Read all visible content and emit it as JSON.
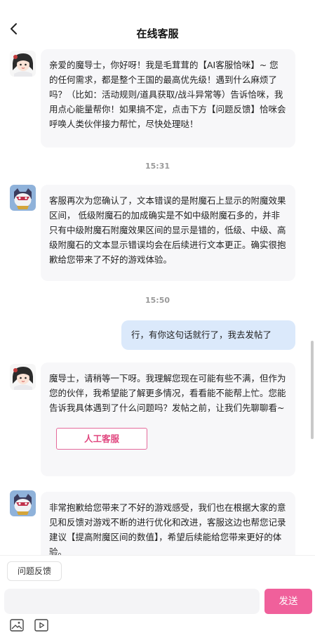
{
  "header": {
    "title": "在线客服",
    "back_icon": "chevron-left-icon"
  },
  "messages": [
    {
      "side": "left",
      "avatar": "anime-girl-avatar",
      "text": "亲爱的魔导士，你好呀！我是毛茸茸的【AI客服恰咪】~ 您的任何需求，都是整个王国的最高优先级！遇到什么麻烦了吗？（比如：活动规则/道具获取/战斗异常等）告诉恰咪，我用点心能量帮你！如果搞不定，点击下方【问题反馈】恰咪会呼唤人类伙伴接力帮忙，尽快处理哒！"
    },
    {
      "time": "15:31"
    },
    {
      "side": "left",
      "avatar": "robot-mascot-avatar",
      "text": "客服再次为您确认了，文本错误的是附魔石上显示的附魔效果区间，  低级附魔石的加成确实是不如中级附魔石多的，并非只有中级附魔石附魔效果区间的显示是错的，低级、中级、高级附魔石的文本显示错误均会在后续进行文本更正。确实很抱歉给您带来了不好的游戏体验。"
    },
    {
      "time": "15:50"
    },
    {
      "side": "right",
      "text": "行，有你这句话就行了，我去发帖了"
    },
    {
      "side": "left",
      "avatar": "anime-girl-avatar",
      "text": "魔导士，请稍等一下呀。我理解您现在可能有些不满，但作为您的伙伴，我希望能了解更多情况，看看能不能帮上忙。您能告诉我具体遇到了什么问题吗？发帖之前，让我们先聊聊看~",
      "button": "人工客服"
    },
    {
      "side": "left",
      "avatar": "robot-mascot-avatar",
      "text": "非常抱歉给您带来了不好的游戏感受，我们也在根据大家的意见和反馈对游戏不断的进行优化和改进，客服这边也帮您记录建议【提高附魔区间的数值】，希望后续能给您带来更好的体验。"
    }
  ],
  "footer": {
    "feedback_chip": "问题反馈",
    "input_value": "",
    "input_placeholder": "",
    "send_label": "发送",
    "tools": [
      "image-icon",
      "video-icon"
    ]
  },
  "colors": {
    "accent": "#f0609b",
    "user_bubble": "#dbe9fb",
    "bot_bubble": "#f7f7f9",
    "button_border": "#e46a9b"
  }
}
